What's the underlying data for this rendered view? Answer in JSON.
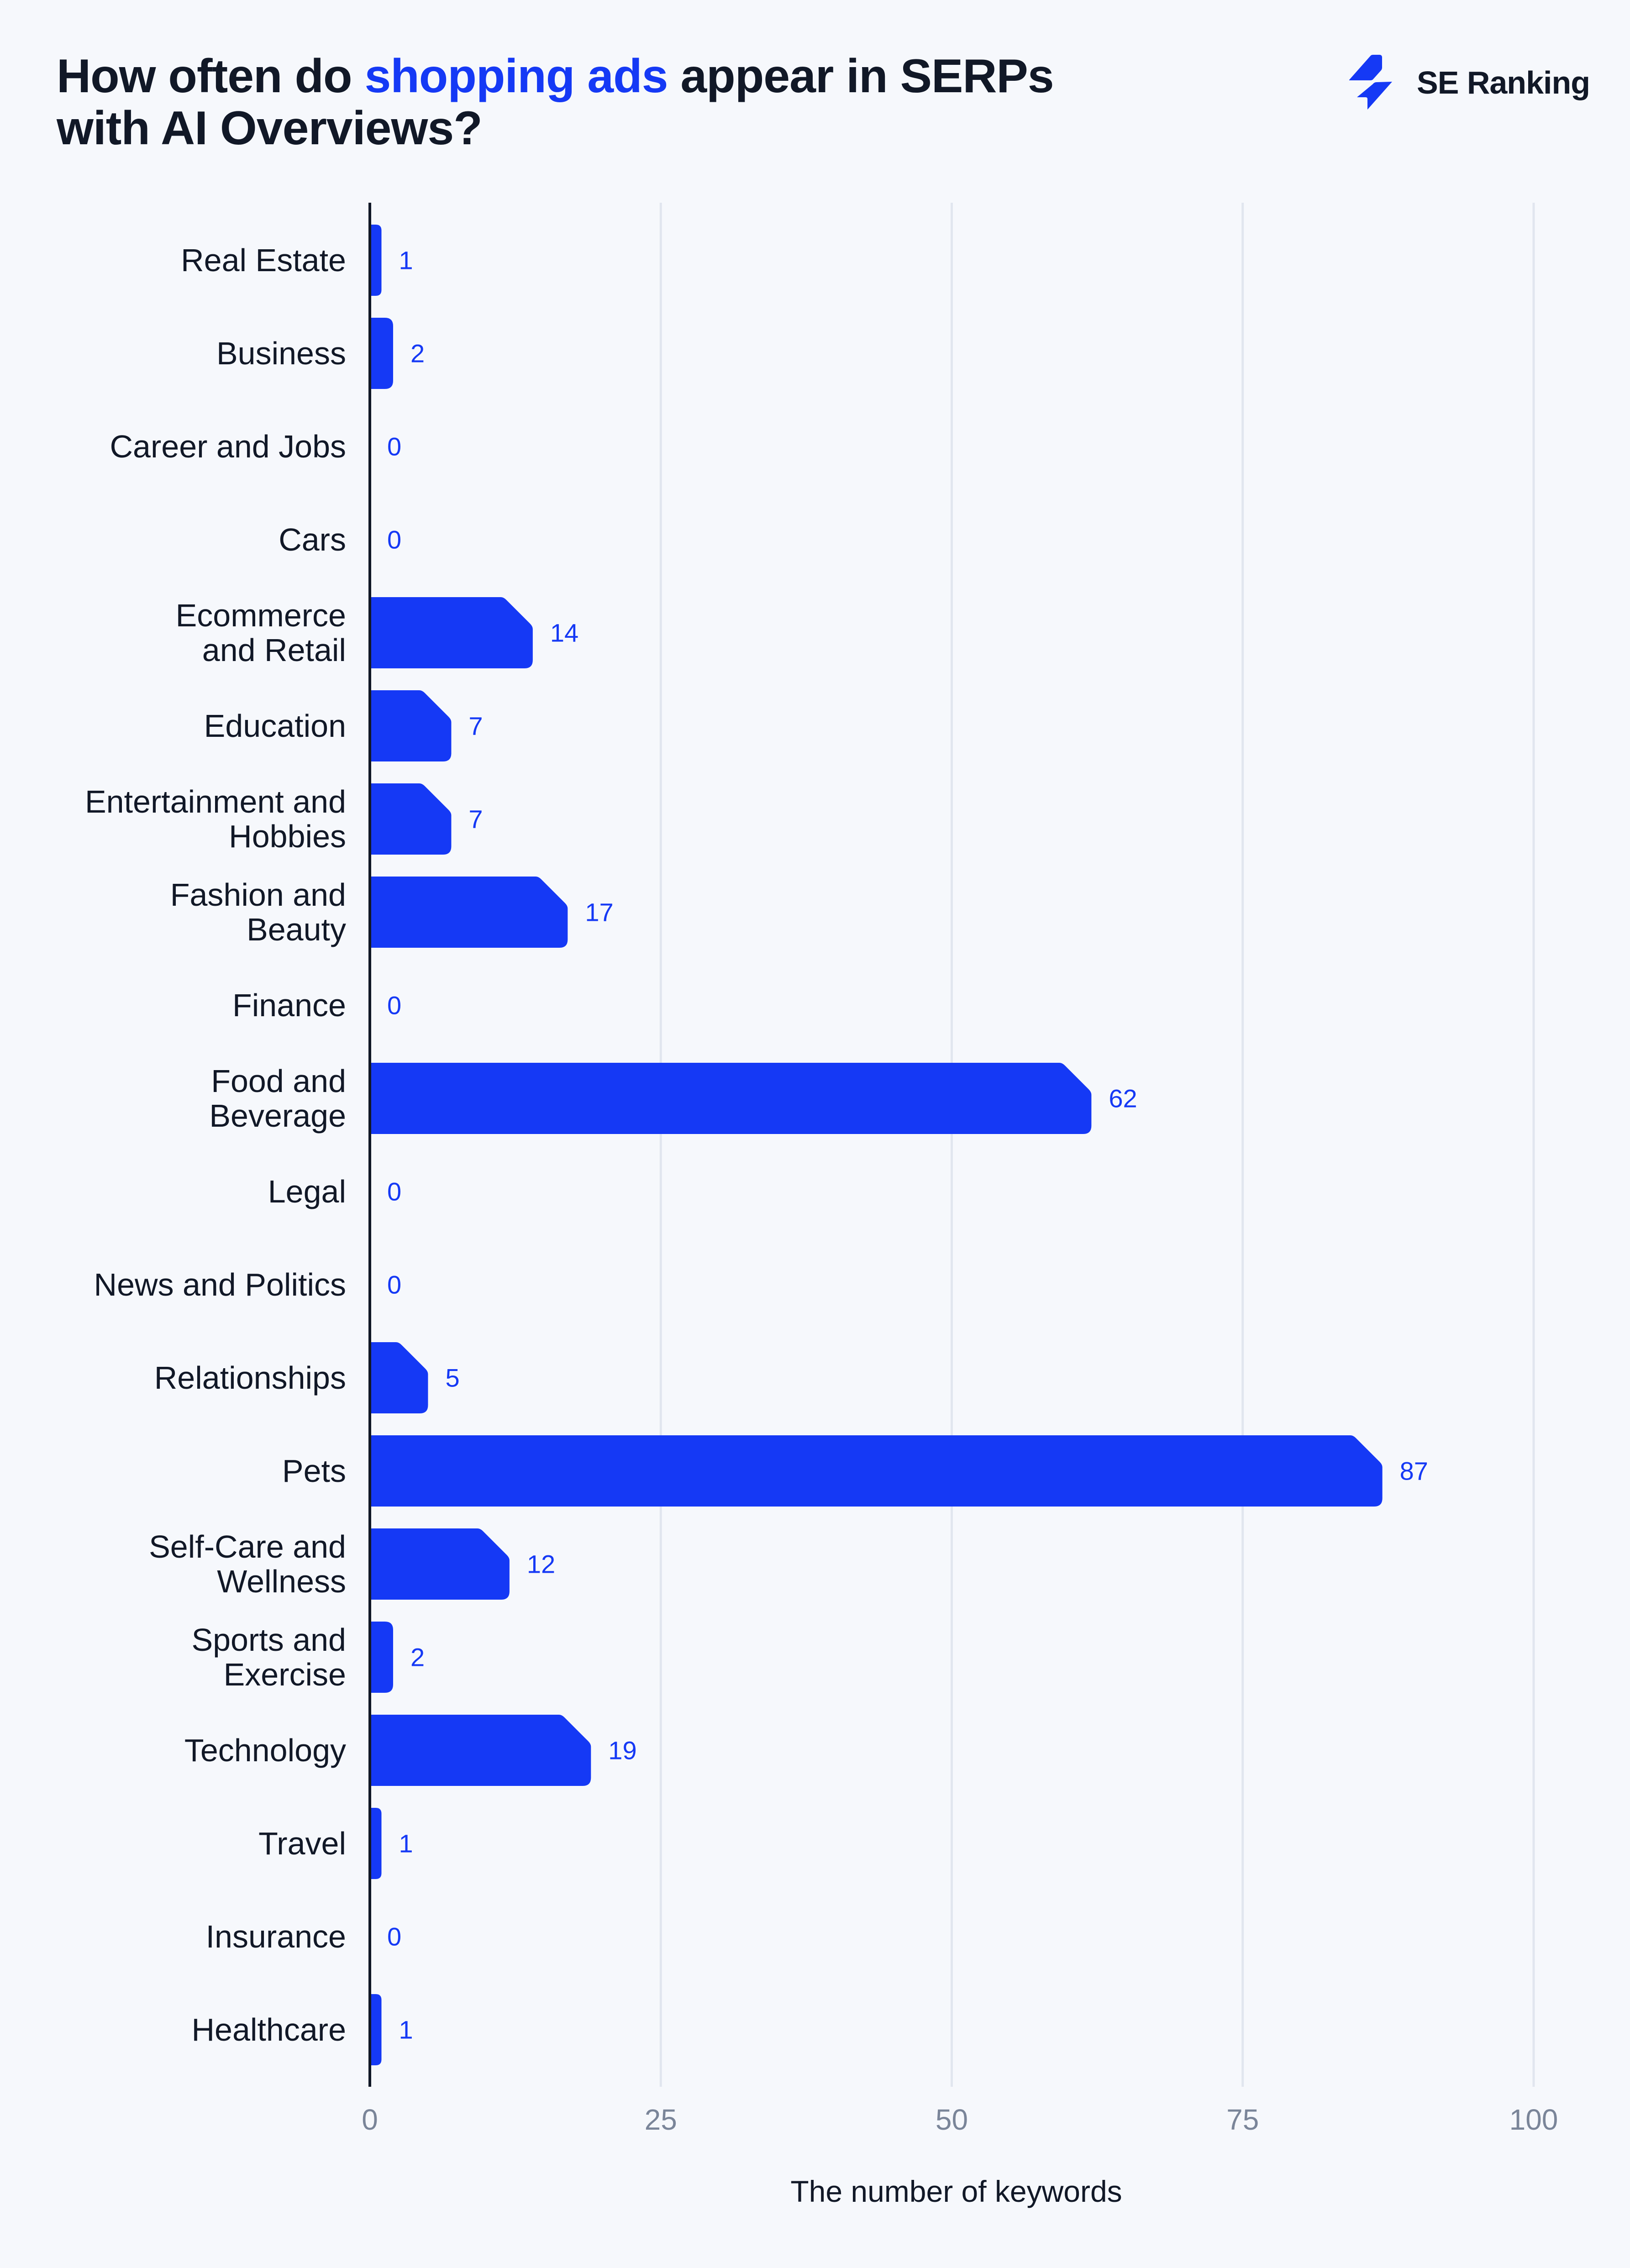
{
  "header": {
    "title_part1": "How often do ",
    "title_highlight": "shopping ads",
    "title_part2": " appear in SERPs",
    "title_line2": "with AI Overviews?",
    "brand": {
      "name": "SE Ranking",
      "icon": "lightning-bolt-logo-icon"
    }
  },
  "colors": {
    "bar": "#1539F5",
    "value_label": "#1539F5",
    "title_highlight": "#1539F5",
    "text": "#111827",
    "tick_label": "#7A8599",
    "gridline": "#E1E6EF",
    "axis_line": "#111827",
    "background": "#F6F8FC"
  },
  "chart_data": {
    "type": "bar",
    "orientation": "horizontal",
    "title": "How often do shopping ads appear in SERPs with AI Overviews?",
    "xlabel": "The number of keywords",
    "ylabel": "",
    "xlim": [
      0,
      100
    ],
    "xticks": [
      0,
      25,
      50,
      75,
      100
    ],
    "grid": true,
    "legend": "none",
    "categories": [
      [
        "Real Estate"
      ],
      [
        "Business"
      ],
      [
        "Career and Jobs"
      ],
      [
        "Cars"
      ],
      [
        "Ecommerce",
        "and Retail"
      ],
      [
        "Education"
      ],
      [
        "Entertainment and",
        "Hobbies"
      ],
      [
        "Fashion and",
        "Beauty"
      ],
      [
        "Finance"
      ],
      [
        "Food and",
        "Beverage"
      ],
      [
        "Legal"
      ],
      [
        "News and Politics"
      ],
      [
        "Relationships"
      ],
      [
        "Pets"
      ],
      [
        "Self-Care and",
        "Wellness"
      ],
      [
        "Sports and",
        "Exercise"
      ],
      [
        "Technology"
      ],
      [
        "Travel"
      ],
      [
        "Insurance"
      ],
      [
        "Healthcare"
      ]
    ],
    "values": [
      1,
      2,
      0,
      0,
      14,
      7,
      7,
      17,
      0,
      62,
      0,
      0,
      5,
      87,
      12,
      2,
      19,
      1,
      0,
      1
    ]
  }
}
